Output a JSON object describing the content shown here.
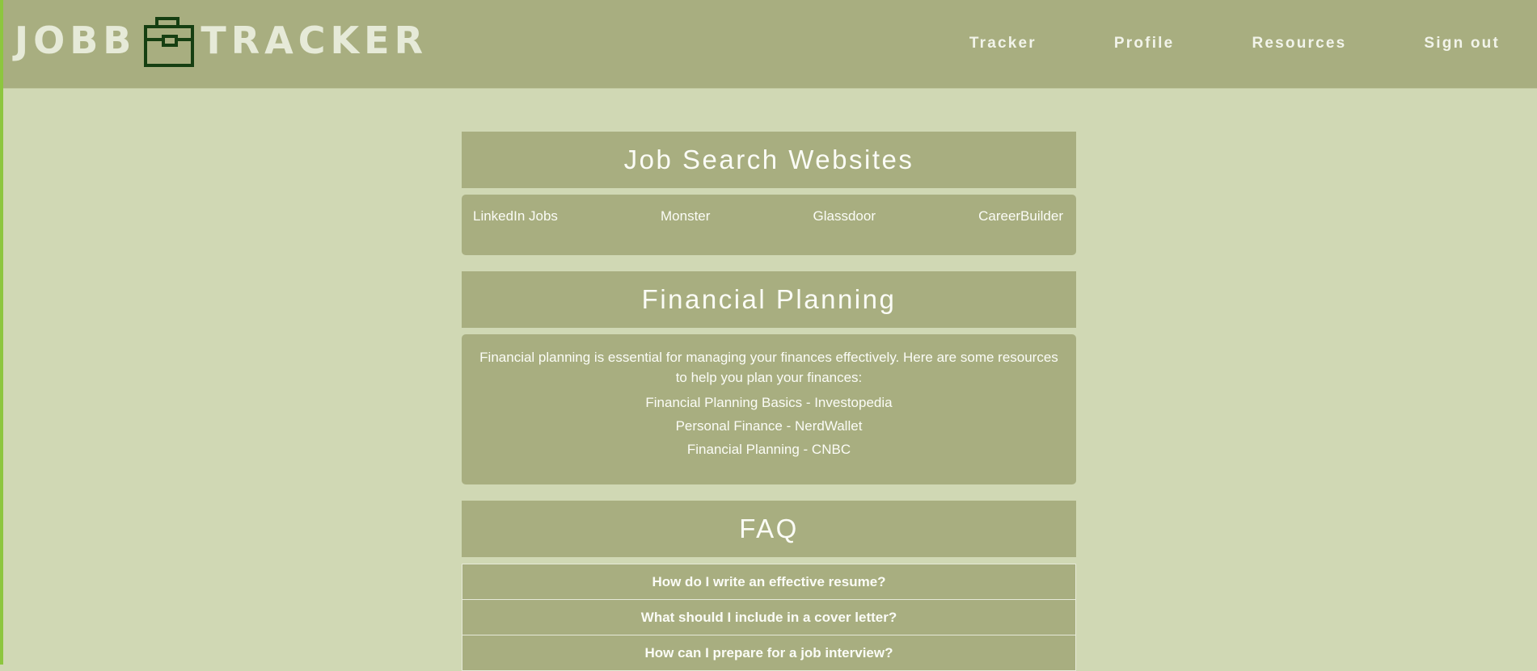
{
  "brand": {
    "left": "JOBB",
    "right": "TRACKER",
    "icon": "briefcase-icon"
  },
  "nav": {
    "items": [
      {
        "label": "Tracker"
      },
      {
        "label": "Profile"
      },
      {
        "label": "Resources"
      },
      {
        "label": "Sign out"
      }
    ]
  },
  "job_sites": {
    "title": "Job Search Websites",
    "links": [
      {
        "label": "LinkedIn Jobs"
      },
      {
        "label": "Monster"
      },
      {
        "label": "Glassdoor"
      },
      {
        "label": "CareerBuilder"
      }
    ]
  },
  "financial": {
    "title": "Financial Planning",
    "intro": "Financial planning is essential for managing your finances effectively. Here are some resources to help you plan your finances:",
    "links": [
      {
        "label": "Financial Planning Basics - Investopedia"
      },
      {
        "label": "Personal Finance - NerdWallet"
      },
      {
        "label": "Financial Planning - CNBC"
      }
    ]
  },
  "faq": {
    "title": "FAQ",
    "questions": [
      {
        "label": "How do I write an effective resume?"
      },
      {
        "label": "What should I include in a cover letter?"
      },
      {
        "label": "How can I prepare for a job interview?"
      }
    ]
  },
  "colors": {
    "background": "#d0d8b4",
    "panel": "#a8ae80",
    "accent_edge": "#8dc63f",
    "icon_dark": "#163f12",
    "text_light": "#fbfcf6"
  }
}
